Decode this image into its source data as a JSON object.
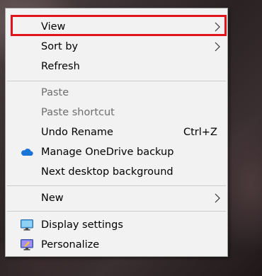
{
  "menu": {
    "items": [
      {
        "label": "View",
        "chevron": true,
        "disabled": false
      },
      {
        "label": "Sort by",
        "chevron": true,
        "disabled": false
      },
      {
        "label": "Refresh",
        "disabled": false
      },
      {
        "label": "Paste",
        "disabled": true
      },
      {
        "label": "Paste shortcut",
        "disabled": true
      },
      {
        "label": "Undo Rename",
        "shortcut": "Ctrl+Z",
        "disabled": false
      },
      {
        "label": "Manage OneDrive backup",
        "icon": "onedrive-cloud-icon",
        "disabled": false
      },
      {
        "label": "Next desktop background",
        "disabled": false
      },
      {
        "label": "New",
        "chevron": true,
        "disabled": false
      },
      {
        "label": "Display settings",
        "icon": "display-monitor-icon",
        "disabled": false
      },
      {
        "label": "Personalize",
        "icon": "personalize-icon",
        "disabled": false
      }
    ]
  },
  "colors": {
    "menu_background": "#f2f2f2",
    "highlight_border": "#e1141d",
    "disabled_text": "#6d6d6d",
    "onedrive_blue": "#1a73d6"
  }
}
